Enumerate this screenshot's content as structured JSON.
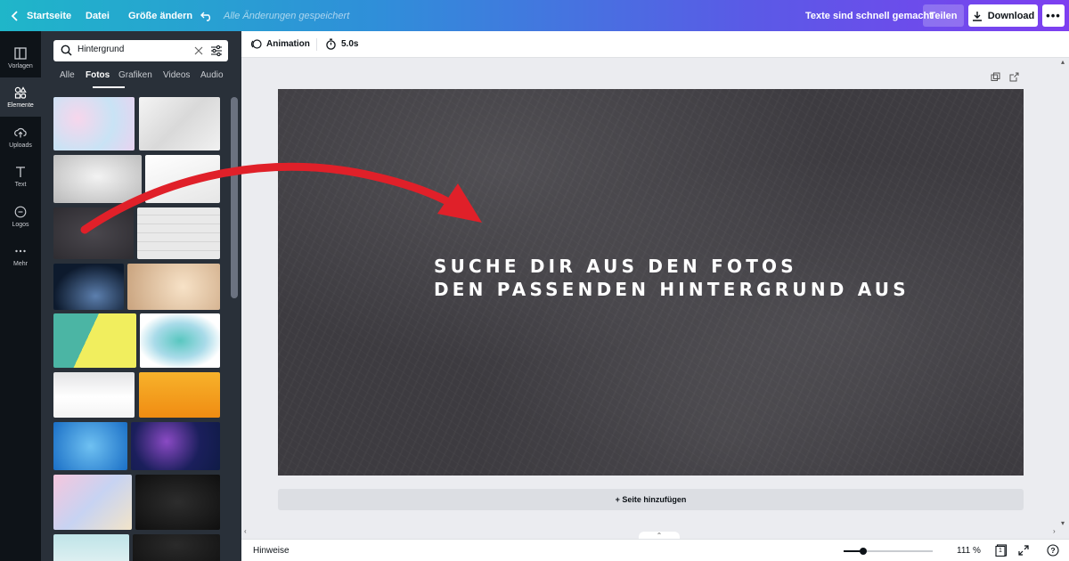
{
  "topbar": {
    "home": "Startseite",
    "file": "Datei",
    "resize": "Größe ändern",
    "saved_status": "Alle Änderungen gespeichert",
    "design_title": "Texte sind schnell gemacht",
    "share": "Teilen",
    "download": "Download"
  },
  "rail": [
    {
      "label": "Vorlagen",
      "icon": "templates-icon"
    },
    {
      "label": "Elemente",
      "icon": "elements-icon"
    },
    {
      "label": "Uploads",
      "icon": "upload-icon"
    },
    {
      "label": "Text",
      "icon": "text-icon"
    },
    {
      "label": "Logos",
      "icon": "logo-icon"
    },
    {
      "label": "Mehr",
      "icon": "more-icon"
    }
  ],
  "panel": {
    "search_value": "Hintergrund",
    "tabs": [
      "Alle",
      "Fotos",
      "Grafiken",
      "Videos",
      "Audio"
    ],
    "active_tab": "Fotos"
  },
  "toolbar": {
    "animation": "Animation",
    "duration": "5.0s"
  },
  "canvas": {
    "headline_line1": "SUCHE DIR AUS DEN FOTOS",
    "headline_line2": "DEN PASSENDEN HINTERGRUND AUS",
    "add_page": "+ Seite hinzufügen",
    "background": "dark chalkboard",
    "arrow_color": "#e02029"
  },
  "bottombar": {
    "hints": "Hinweise",
    "zoom": "111 %",
    "zoom_level": 0.22,
    "page_number": "1"
  }
}
